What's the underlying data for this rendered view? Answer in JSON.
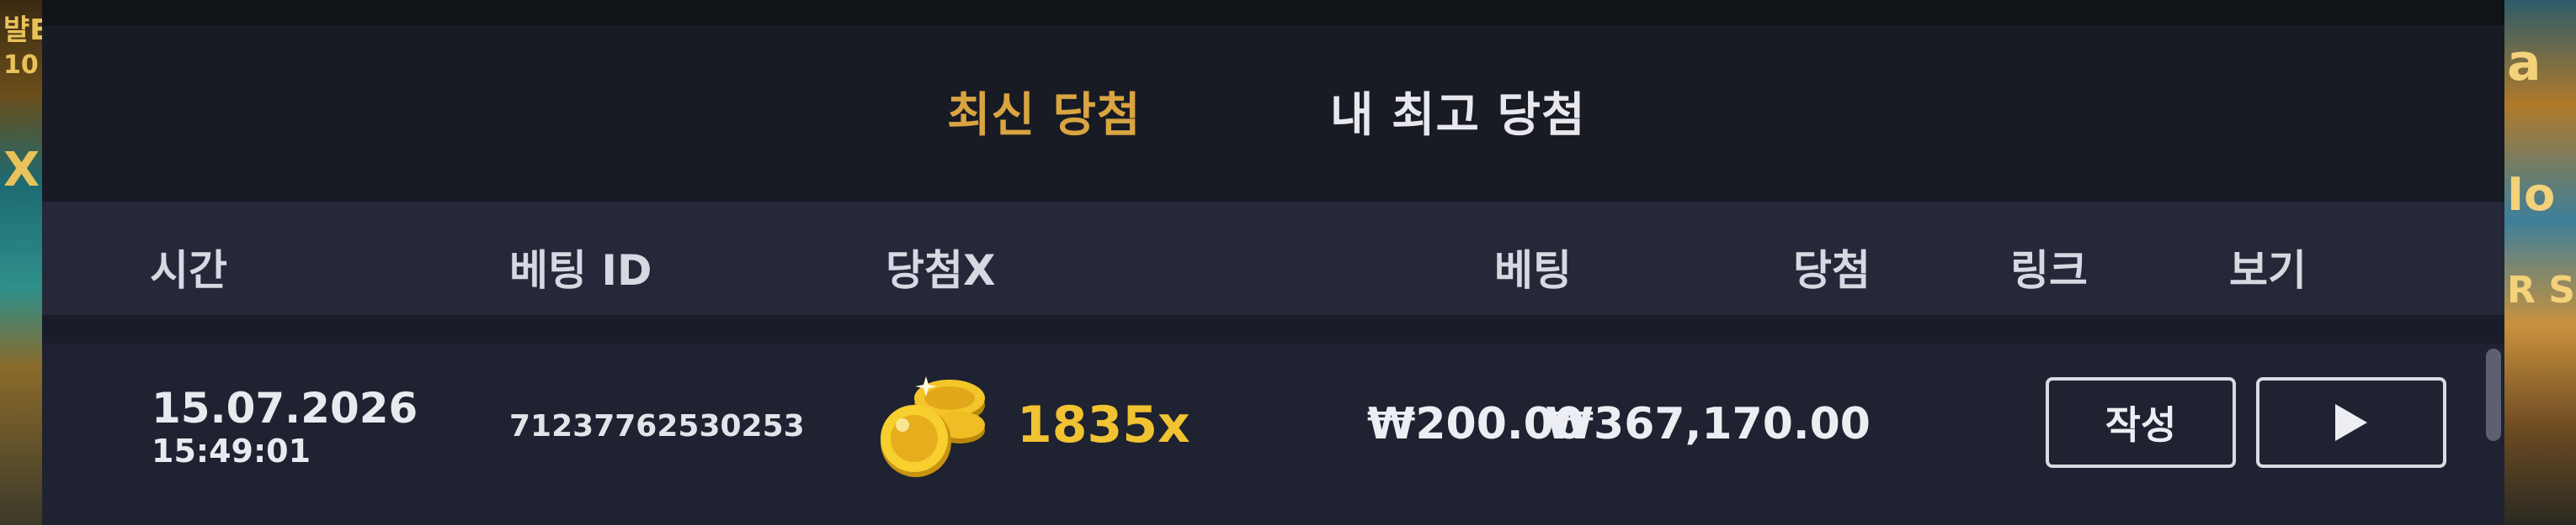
{
  "tabs": [
    {
      "label": "최신 당첨",
      "active": true
    },
    {
      "label": "내 최고 당첨",
      "active": false
    }
  ],
  "table": {
    "headers": [
      "시간",
      "베팅 ID",
      "당첨X",
      "베팅",
      "당첨",
      "링크",
      "보기"
    ],
    "rows": [
      {
        "date": "15.07.2026",
        "time": "15:49:01",
        "bet_id": "71237762530253",
        "multiplier": "1835x",
        "bet": "₩200.00",
        "win": "₩367,170.00",
        "link_label": "작성",
        "view_icon": "play-icon"
      }
    ]
  },
  "colors": {
    "active_tab": "#d9a441",
    "multiplier": "#f1c232",
    "background": "#181b24",
    "header_row": "#242838"
  }
}
